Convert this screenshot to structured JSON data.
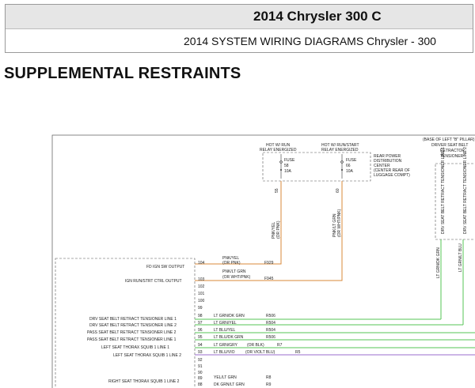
{
  "header": {
    "title": "2014 Chrysler 300 C",
    "subtitle": "2014 SYSTEM WIRING DIAGRAMS Chrysler - 300"
  },
  "section_title": "SUPPLEMENTAL RESTRAINTS",
  "diagram": {
    "relay_left": [
      "HOT W/ RUN",
      "RELAY ENERGIZED"
    ],
    "relay_right": [
      "HOT W/ RUN/START",
      "RELAY ENERGIZED"
    ],
    "fuse_left": [
      "FUSE",
      "58",
      "10A"
    ],
    "fuse_right": [
      "FUSE",
      "66",
      "10A"
    ],
    "pdc_label": [
      "REAR POWER",
      "DISTRIBUTION",
      "CENTER",
      "(CENTER REAR OF",
      "LUGGAGE COMPT)"
    ],
    "pdc_pin_left": "55",
    "pdc_pin_right": "60",
    "tensioner_label": [
      "(BASE OF LEFT \"B\" PILLAR)",
      "DRIVER SEAT BELT",
      "RETRACTOR",
      "TENSIONER"
    ],
    "tensioner_line1": "DRV SEAT BELT RETRACT TENSIONER LINE 1",
    "tensioner_line2": "DRV SEAT BELT RETRACT TENSIONER LINE 2",
    "vert_wire_left_color": "PNK/YEL",
    "vert_wire_left_alt": "(OR PNK)",
    "vert_wire_right_color": "PNK/LT GRN",
    "vert_wire_right_alt": "(OR WHT/PNK)",
    "tensioner_wire_a": "LT GRN/DK GRN",
    "tensioner_wire_b": "LT GRN/LT BLU",
    "module_rows": [
      {
        "label": "FD IGN SW OUTPUT",
        "pin": "104",
        "wire": "PNK/YEL",
        "alt": "(OR PNK)",
        "circuit": "F929"
      },
      {
        "label": "",
        "pin": "",
        "wire": "PNK/LT GRN",
        "alt": "(OR WHT/PNK)",
        "circuit": ""
      },
      {
        "label": "IGN RUN/STRT CTRL OUTPUT",
        "pin": "103",
        "wire": "",
        "alt": "",
        "circuit": "F945"
      },
      {
        "label": "",
        "pin": "102",
        "wire": "",
        "alt": "",
        "circuit": ""
      },
      {
        "label": "",
        "pin": "101",
        "wire": "",
        "alt": "",
        "circuit": ""
      },
      {
        "label": "",
        "pin": "100",
        "wire": "",
        "alt": "",
        "circuit": ""
      },
      {
        "label": "",
        "pin": "99",
        "wire": "",
        "alt": "",
        "circuit": ""
      },
      {
        "label": "DRV SEAT BELT RETRACT TENSIONER LINE 1",
        "pin": "98",
        "wire": "LT GRN/DK GRN",
        "alt": "",
        "circuit": "R506"
      },
      {
        "label": "DRV SEAT BELT RETRACT TENSIONER LINE 2",
        "pin": "97",
        "wire": "LT GRN/YEL",
        "alt": "",
        "circuit": "R504"
      },
      {
        "label": "PASS SEAT BELT RETRACT TENSIONER LINE 2",
        "pin": "96",
        "wire": "LT BLU/YEL",
        "alt": "",
        "circuit": "R504"
      },
      {
        "label": "PASS SEAT BELT RETRACT TENSIONER LINE 1",
        "pin": "95",
        "wire": "LT BLU/DK GRN",
        "alt": "",
        "circuit": "R506"
      },
      {
        "label": "LEFT SEAT THORAX SQUIB 1 LINE 1",
        "pin": "94",
        "wire": "LT GRN/GRY",
        "alt": "(OR BLK)",
        "circuit": "R7"
      },
      {
        "label": "LEFT SEAT THORAX SQUIB 1 LINE 2",
        "pin": "93",
        "wire": "LT BLU/VIO",
        "alt": "(OR VIOLT BLU)",
        "circuit": "R5"
      },
      {
        "label": "",
        "pin": "92",
        "wire": "",
        "alt": "",
        "circuit": ""
      },
      {
        "label": "",
        "pin": "91",
        "wire": "",
        "alt": "",
        "circuit": ""
      },
      {
        "label": "",
        "pin": "90",
        "wire": "",
        "alt": "",
        "circuit": ""
      },
      {
        "label": "",
        "pin": "89",
        "wire": "YEL/LT GRN",
        "alt": "",
        "circuit": "R8"
      },
      {
        "label": "RIGHT SEAT THORAX SQUIB 1 LINE 2",
        "pin": "88",
        "wire": "DK GRN/LT GRN",
        "alt": "",
        "circuit": "R9"
      }
    ],
    "colors": {
      "orange_wire": "#d98a3a",
      "green_wire": "#55c455",
      "purple_wire": "#9a6ccc"
    }
  }
}
